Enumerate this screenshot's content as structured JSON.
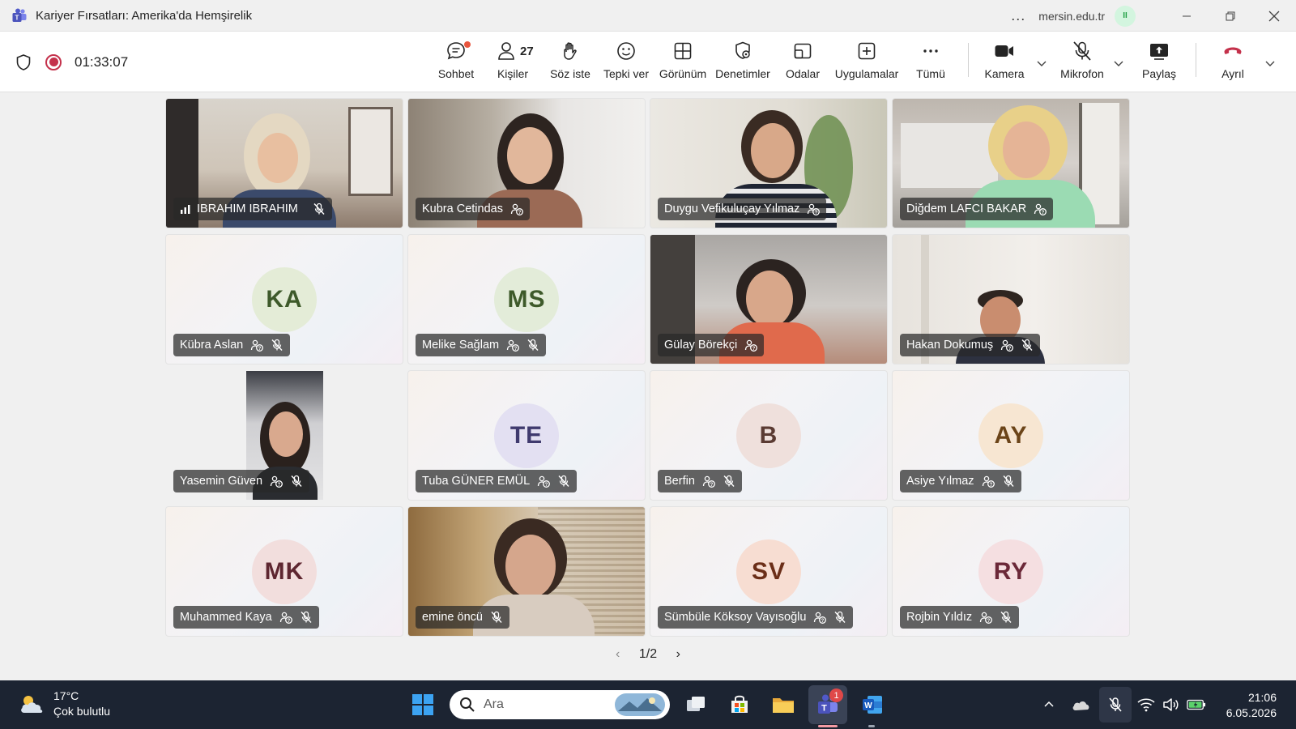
{
  "window": {
    "title": "Kariyer Fırsatları: Amerika'da Hemşirelik",
    "more": "...",
    "org": "mersin.edu.tr",
    "pause_icon": "II"
  },
  "toolbar": {
    "timer": "01:33:07",
    "people_count": "27",
    "buttons": {
      "chat": "Sohbet",
      "people": "Kişiler",
      "raise": "Söz iste",
      "react": "Tepki ver",
      "view": "Görünüm",
      "controls": "Denetimler",
      "rooms": "Odalar",
      "apps": "Uygulamalar",
      "more": "Tümü",
      "camera": "Kamera",
      "mic": "Mikrofon",
      "share": "Paylaş",
      "leave": "Ayrıl"
    }
  },
  "participants": [
    {
      "name": "IBRAHIM IBRAHIM",
      "video": true
    },
    {
      "name": "Kubra Cetindas",
      "video": true
    },
    {
      "name": "Duygu Vefikuluçay Yılmaz",
      "video": true
    },
    {
      "name": "Diğdem LAFCI BAKAR",
      "video": true
    },
    {
      "name": "Kübra Aslan",
      "initials": "KA",
      "video": false
    },
    {
      "name": "Melike Sağlam",
      "initials": "MS",
      "video": false
    },
    {
      "name": "Gülay Börekçi",
      "video": true
    },
    {
      "name": "Hakan Dokumuş",
      "video": true
    },
    {
      "name": "Yasemin Güven",
      "video": true
    },
    {
      "name": "Tuba GÜNER EMÜL",
      "initials": "TE",
      "video": false
    },
    {
      "name": "Berfin",
      "initials": "B",
      "video": false
    },
    {
      "name": "Asiye Yılmaz",
      "initials": "AY",
      "video": false
    },
    {
      "name": "Muhammed Kaya",
      "initials": "MK",
      "video": false
    },
    {
      "name": "emine öncü",
      "video": true
    },
    {
      "name": "Sümbüle Köksoy Vayısoğlu",
      "initials": "SV",
      "video": false
    },
    {
      "name": "Rojbin Yıldız",
      "initials": "RY",
      "video": false
    }
  ],
  "pager": {
    "label": "1/2",
    "prev": "‹",
    "next": "›"
  },
  "taskbar": {
    "weather_temp": "17°C",
    "weather_desc": "Çok bulutlu",
    "search_placeholder": "Ara",
    "teams_badge": "1",
    "time": "21:06",
    "date": "6.05.2026"
  },
  "colors": {
    "record": "#c4314b",
    "leave": "#c4314b",
    "taskbar": "#1c2432",
    "avatar_KA": "#e4ecd7",
    "avatar_MS": "#e3ecd9",
    "avatar_TE": "#e3e0f2",
    "avatar_B": "#efe0dc",
    "avatar_AY": "#f7e6d2",
    "avatar_MK": "#f2dedd",
    "avatar_SV": "#f7ddd2",
    "avatar_RY": "#f5dfe1"
  }
}
